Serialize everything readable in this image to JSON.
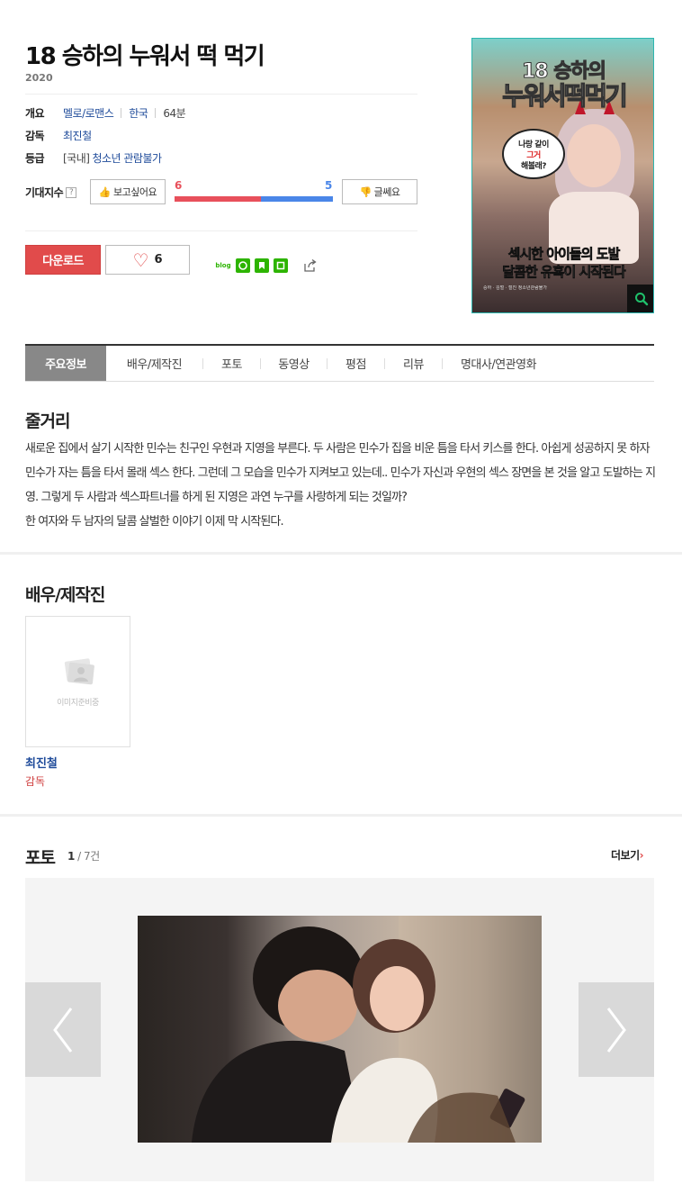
{
  "movie": {
    "title": "18 승하의 누워서 떡 먹기",
    "year": "2020",
    "overview_label": "개요",
    "genre": "멜로/로맨스",
    "country": "한국",
    "runtime": "64분",
    "director_label": "감독",
    "director": "최진철",
    "rating_label": "등급",
    "rating_prefix": "[국내]",
    "rating": "청소년 관람불가"
  },
  "expect": {
    "label": "기대지수",
    "help": "?",
    "want_label": "보고싶어요",
    "want_count": "6",
    "meh_label": "글쎄요",
    "meh_count": "5",
    "want_fraction": 0.545,
    "want_color": "#e8505b",
    "meh_color": "#4a86e8"
  },
  "actions": {
    "download_label": "다운로드",
    "like_count": "6",
    "share_icons": [
      "blog-icon",
      "cafe-icon",
      "bookmark-icon",
      "band-icon",
      "share-icon"
    ]
  },
  "poster": {
    "line1": "18 승하의",
    "line2": "누워서떡먹기",
    "bubble1": "나랑 같이",
    "bubble2": "그거",
    "bubble3": "해볼래?",
    "catch1": "섹시한 아이돌의 도발",
    "catch2": "달콤한 유혹이 시작된다",
    "credits": "승하 · 김벌 · 철진  청소년관람불가"
  },
  "tabs": [
    "주요정보",
    "배우/제작진",
    "포토",
    "동영상",
    "평점",
    "리뷰",
    "명대사/연관영화"
  ],
  "synopsis": {
    "heading": "줄거리",
    "text": "새로운 집에서 살기 시작한 민수는 친구인 우현과 지영을 부른다. 두 사람은 민수가 집을 비운 틈을 타서 키스를 한다. 아쉽게 성공하지 못 하자 민수가 자는 틈을 타서 몰래 섹스 한다. 그런데 그 모습을 민수가 지켜보고 있는데.. 민수가 자신과 우현의 섹스 장면을 본 것을 알고 도발하는 지영. 그렇게 두 사람과 섹스파트너를 하게 된 지영은 과연 누구를 사랑하게 되는 것일까?\n 한 여자와 두 남자의 달콤 살벌한 이야기 이제 막 시작된다."
  },
  "cast": {
    "heading": "배우/제작진",
    "placeholder": "이미지준비중",
    "items": [
      {
        "name": "최진철",
        "role": "감독"
      }
    ]
  },
  "photo": {
    "heading": "포토",
    "current": "1",
    "total": " / 7건",
    "more_label": "더보기",
    "more_arrow": "›"
  }
}
